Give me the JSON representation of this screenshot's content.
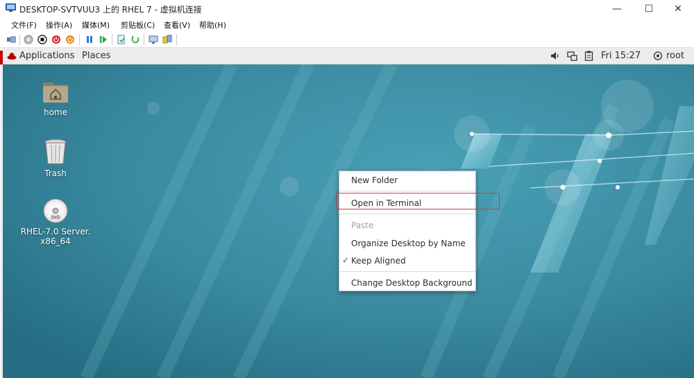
{
  "window": {
    "title": "DESKTOP-SVTVUU3 上的 RHEL 7 - 虚拟机连接",
    "controls": {
      "minimize": "—",
      "maximize": "☐",
      "close": "✕"
    }
  },
  "menubar": {
    "items": [
      "文件(F)",
      "操作(A)",
      "媒体(M)",
      "剪贴板(C)",
      "查看(V)",
      "帮助(H)"
    ]
  },
  "toolbar": {
    "icons": [
      "ctrl-alt-del-icon",
      "start-icon",
      "turn-off-icon",
      "shut-down-icon",
      "save-icon",
      "pause-icon",
      "reset-icon",
      "checkpoint-icon",
      "revert-icon",
      "enhanced-session-icon",
      "share-icon"
    ]
  },
  "panel": {
    "applications": "Applications",
    "places": "Places",
    "clock": "Fri 15:27",
    "user": "root"
  },
  "desktop": {
    "icons": [
      {
        "label": "home"
      },
      {
        "label": "Trash"
      },
      {
        "label_line1": "RHEL-7.0 Server.",
        "label_line2": "x86_64",
        "badge": "DVD"
      }
    ]
  },
  "context_menu": {
    "items": {
      "new_folder": "New Folder",
      "open_terminal": "Open in Terminal",
      "paste": "Paste",
      "organize": "Organize Desktop by Name",
      "keep_aligned": "Keep Aligned",
      "change_background": "Change Desktop Background"
    },
    "keep_aligned_checked": "✓"
  },
  "colors": {
    "wallpaper_base": "#3d8ca2",
    "highlight_box": "#d33c3c",
    "panel_bg": "#ececec"
  }
}
